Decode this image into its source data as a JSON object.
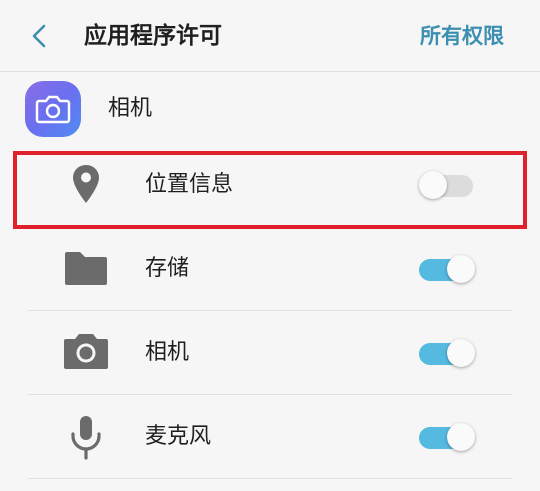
{
  "header": {
    "title": "应用程序许可",
    "action_label": "所有权限"
  },
  "app": {
    "name": "相机",
    "icon": "camera-app-icon"
  },
  "permissions": [
    {
      "label": "位置信息",
      "icon": "location-pin-icon",
      "enabled": false,
      "highlighted": true
    },
    {
      "label": "存储",
      "icon": "folder-icon",
      "enabled": true,
      "highlighted": false
    },
    {
      "label": "相机",
      "icon": "camera-icon",
      "enabled": true,
      "highlighted": false
    },
    {
      "label": "麦克风",
      "icon": "microphone-icon",
      "enabled": true,
      "highlighted": false
    }
  ],
  "colors": {
    "accent": "#3d8fb1",
    "toggle_on": "#55b9e0",
    "highlight": "#e0202a"
  }
}
